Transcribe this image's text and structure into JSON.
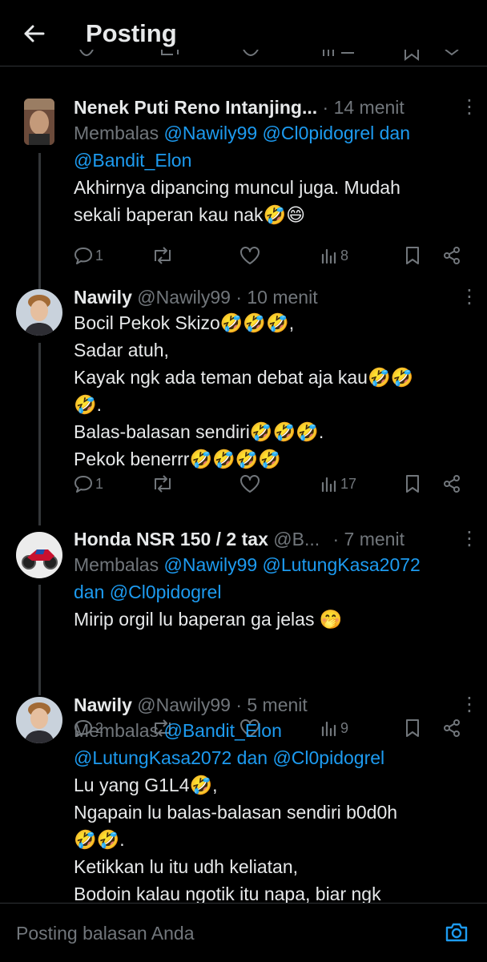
{
  "header": {
    "title": "Posting"
  },
  "posts": [
    {
      "name": "Nenek Puti Reno Intanjing...",
      "handle": "",
      "time": "· 14 menit",
      "reply_prefix": "Membalas ",
      "reply_line1": "@Nawily99 @Cl0pidogrel dan",
      "reply_line2": "@Bandit_Elon",
      "body": "Akhirnya dipancing muncul juga. Mudah\nsekali baperan kau nak🤣😄",
      "replies": "1",
      "views": "8"
    },
    {
      "name": "Nawily",
      "handle": "@Nawily99",
      "time": "· 10 menit",
      "body": "Bocil Pekok Skizo🤣🤣🤣,\nSadar atuh,\nKayak ngk ada teman debat aja kau🤣🤣\n🤣.\nBalas-balasan sendiri🤣🤣🤣.\nPekok benerrr🤣🤣🤣🤣",
      "replies": "1",
      "views": "17"
    },
    {
      "name": "Honda NSR 150 / 2 tax",
      "handle": "@B...",
      "time": "· 7 menit",
      "reply_prefix": "Membalas ",
      "reply_line1": "@Nawily99 @LutungKasa2072",
      "reply_line2": "dan @Cl0pidogrel",
      "body": "Mirip orgil lu baperan ga jelas 🤭",
      "replies": "2",
      "views": "9"
    },
    {
      "name": "Nawily",
      "handle": "@Nawily99",
      "time": "· 5 menit",
      "reply_prefix": "Membalas ",
      "reply_line1": "@Bandit_Elon",
      "reply_line2": "@LutungKasa2072 dan @Cl0pidogrel",
      "body": "Lu yang G1L4🤣,\nNgapain lu balas-balasan sendiri b0d0h\n🤣🤣.\nKetikkan lu itu udh keliatan,\nBodoin kalau ngotik itu napa, biar ngk"
    }
  ],
  "reply_bar": {
    "placeholder": "Posting balasan Anda"
  },
  "colors": {
    "background": "#000000",
    "link": "#1d9bf0",
    "muted": "#71767b",
    "text": "#e7e9ea"
  },
  "icons": [
    "back-arrow-icon",
    "more-icon",
    "reply-icon",
    "repost-icon",
    "like-icon",
    "views-icon",
    "bookmark-icon",
    "share-icon",
    "camera-icon"
  ]
}
